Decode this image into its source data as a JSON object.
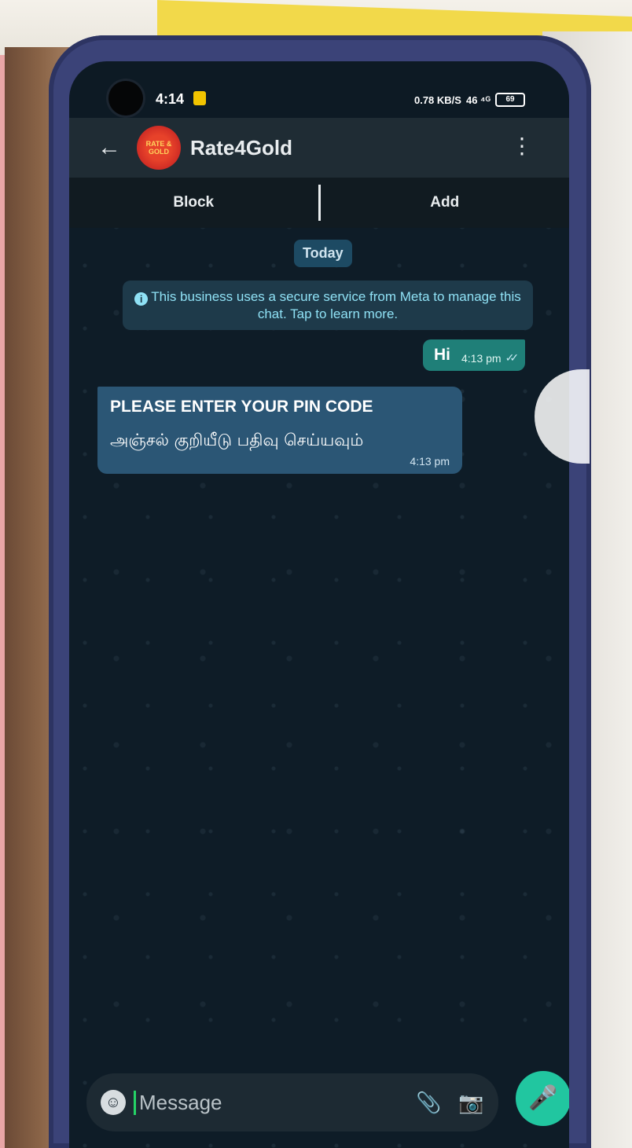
{
  "status_bar": {
    "time": "4:14",
    "network": "0.78 KB/S",
    "signal": "46 ⁴ᴳ",
    "battery": "69"
  },
  "header": {
    "back_icon": "arrow-left",
    "avatar_text": "RATE & GOLD",
    "contact_name": "Rate4Gold",
    "menu_icon": "more-vertical"
  },
  "actions": {
    "block_label": "Block",
    "add_label": "Add"
  },
  "chat": {
    "date_chip": "Today",
    "notice": "This business uses a secure service from Meta to manage this chat. Tap to learn more.",
    "outgoing": {
      "text": "Hi",
      "time": "4:13 pm",
      "status": "read"
    },
    "incoming": {
      "line1": "PLEASE ENTER YOUR PIN CODE",
      "line2": "அஞ்சல் குறியீடு பதிவு செய்யவும்",
      "time": "4:13 pm"
    }
  },
  "composer": {
    "placeholder": "Message"
  },
  "colors": {
    "header_bg": "#1f2c34",
    "outgoing_bubble": "#1f7f78",
    "incoming_bubble": "#2b5675",
    "mic_button": "#21c6a0"
  }
}
